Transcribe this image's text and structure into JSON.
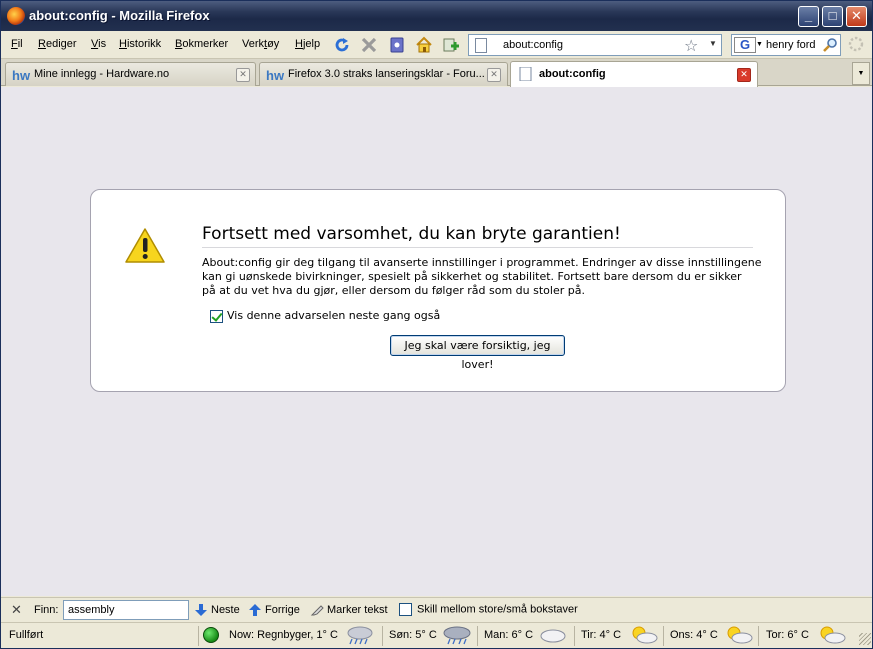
{
  "window": {
    "title": "about:config - Mozilla Firefox",
    "icon": "firefox-icon",
    "minimize": "_",
    "maximize": "□",
    "close": "✕"
  },
  "menu": [
    {
      "label": "Fil",
      "accel": "F"
    },
    {
      "label": "Rediger",
      "accel": "R"
    },
    {
      "label": "Vis",
      "accel": "V"
    },
    {
      "label": "Historikk",
      "accel": "H"
    },
    {
      "label": "Bokmerker",
      "accel": "B"
    },
    {
      "label": "Verktøy",
      "accel": "k"
    },
    {
      "label": "Hjelp",
      "accel": "H"
    }
  ],
  "toolbar": {
    "icons": [
      "reload-icon",
      "stop-icon",
      "bookmark-icon",
      "home-icon",
      "add-icon"
    ]
  },
  "urlbar": {
    "value": "about:config"
  },
  "searchbar": {
    "engine": "G",
    "value": "henry ford"
  },
  "tabs": [
    {
      "label": "Mine innlegg - Hardware.no",
      "favicon": "hw",
      "active": false
    },
    {
      "label": "Firefox 3.0 straks lanseringsklar - Foru...",
      "favicon": "hw",
      "active": false
    },
    {
      "label": "about:config",
      "favicon": "page",
      "active": true
    }
  ],
  "warning": {
    "title": "Fortsett med varsomhet, du kan bryte garantien!",
    "lines": [
      "About:config gir deg tilgang til avanserte innstillinger i programmet. Endringer av disse innstillingene",
      "kan gi uønskede bivirkninger, spesielt på sikkerhet og stabilitet. Fortsett bare dersom du er sikker",
      "på at du vet hva du gjør, eller dersom du følger råd som du stoler på."
    ],
    "checkbox_label": "Vis denne advarselen neste gang også",
    "checkbox_checked": true,
    "button_label": "Jeg skal være forsiktig, jeg lover!"
  },
  "findbar": {
    "close": "✕",
    "label": "Finn:",
    "value": "assembly",
    "next": "Neste",
    "previous": "Forrige",
    "highlight": "Marker tekst",
    "match_case": "Skill mellom store/små bokstaver"
  },
  "statusbar": {
    "status": "Fullført",
    "weather": [
      {
        "text": "Now: Regnbyger, 1° C",
        "icon": "rain-cloud-icon"
      },
      {
        "text": "Søn: 5° C",
        "icon": "storm-cloud-icon"
      },
      {
        "text": "Man: 6° C",
        "icon": "cloud-icon"
      },
      {
        "text": "Tir: 4° C",
        "icon": "sun-cloud-icon"
      },
      {
        "text": "Ons: 4° C",
        "icon": "sun-cloud-icon"
      },
      {
        "text": "Tor: 6° C",
        "icon": "sun-cloud-icon"
      }
    ]
  }
}
